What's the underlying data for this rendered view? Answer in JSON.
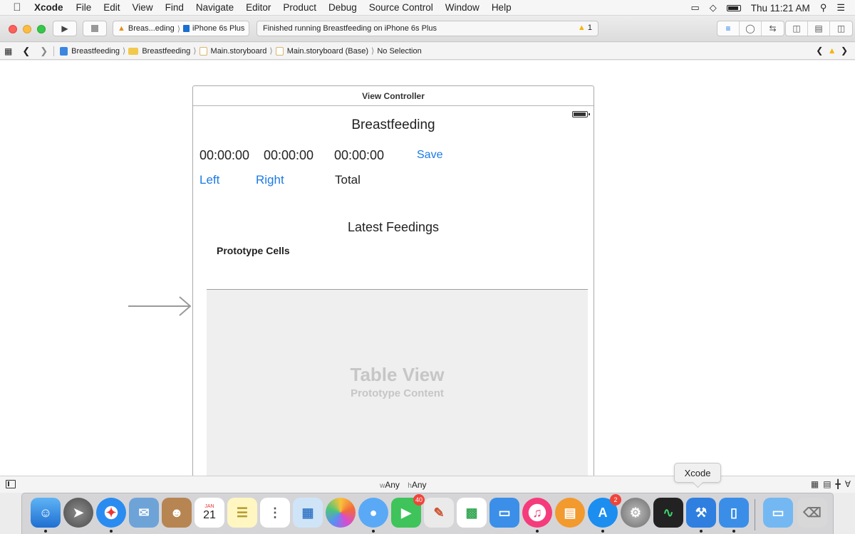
{
  "menubar": {
    "app_name": "Xcode",
    "items": [
      "File",
      "Edit",
      "View",
      "Find",
      "Navigate",
      "Editor",
      "Product",
      "Debug",
      "Source Control",
      "Window",
      "Help"
    ],
    "clock": "Thu 11:21 AM"
  },
  "toolbar": {
    "scheme": "Breas...eding",
    "device": "iPhone 6s Plus",
    "activity_status": "Finished running Breastfeeding on iPhone 6s Plus",
    "warning_count": "1"
  },
  "jumpbar": {
    "crumbs": [
      "Breastfeeding",
      "Breastfeeding",
      "Main.storyboard",
      "Main.storyboard (Base)",
      "No Selection"
    ]
  },
  "storyboard": {
    "scene_title": "View Controller",
    "nav_title": "Breastfeeding",
    "timers": [
      "00:00:00",
      "00:00:00",
      "00:00:00"
    ],
    "save_label": "Save",
    "left_label": "Left",
    "right_label": "Right",
    "total_label": "Total",
    "latest_label": "Latest Feedings",
    "prototype_cells_label": "Prototype Cells",
    "table_title": "Table View",
    "table_subtitle": "Prototype Content"
  },
  "bottombar": {
    "w_prefix": "w",
    "w_value": "Any",
    "h_prefix": "h",
    "h_value": "Any"
  },
  "tooltip": "Xcode",
  "dock": {
    "calendar_month": "JAN",
    "calendar_day": "21",
    "facetime_badge": "40",
    "appstore_badge": "2"
  },
  "colors": {
    "accent_blue": "#1b7ae8",
    "warning": "#f5b400",
    "badge_red": "#f0443a"
  }
}
